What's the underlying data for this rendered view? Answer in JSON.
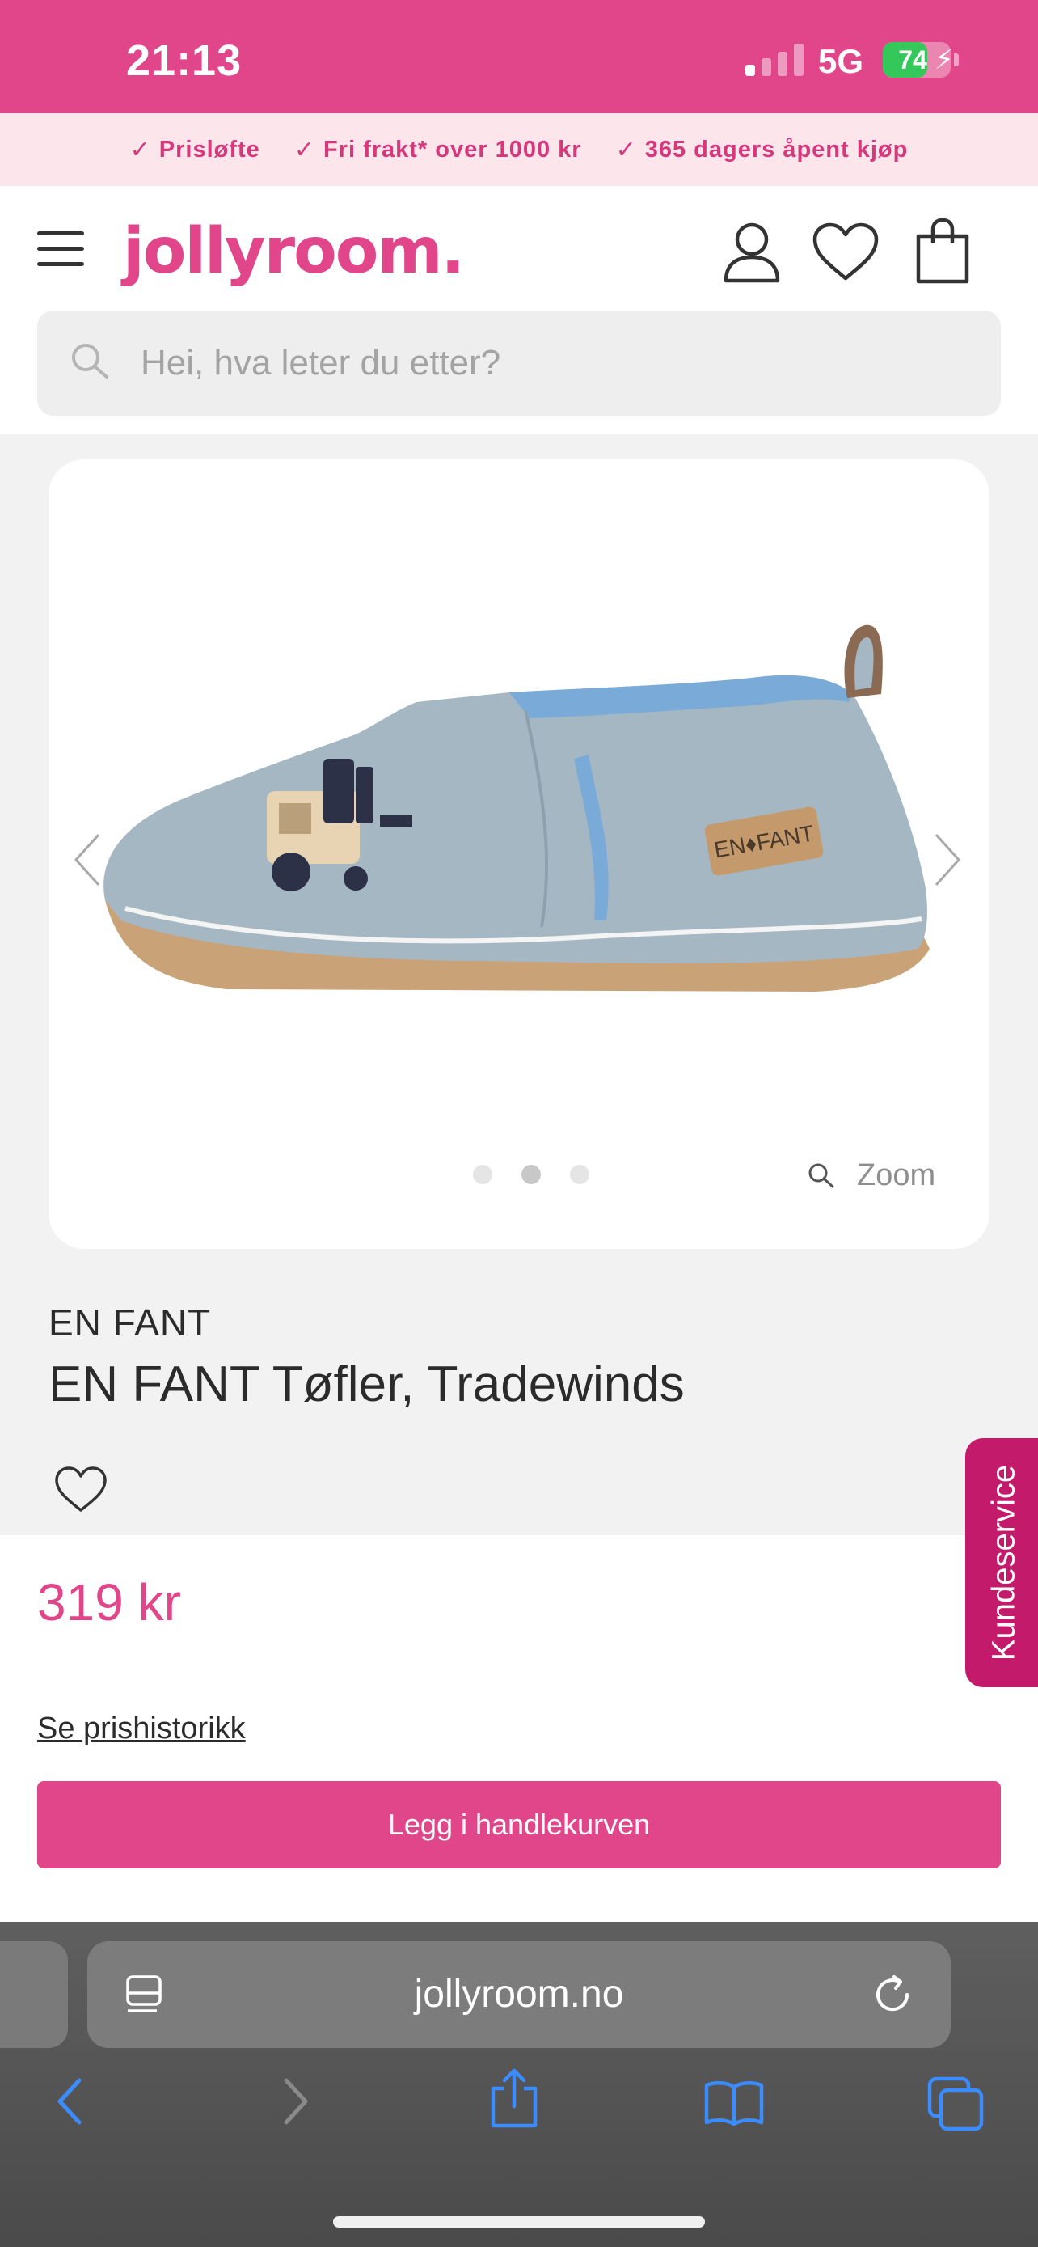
{
  "status_bar": {
    "time": "21:13",
    "network": "5G",
    "battery_percent": "74",
    "battery_level": 0.74,
    "signal_bars_active": 1
  },
  "promo": {
    "items": [
      "Prisløfte",
      "Fri frakt* over 1000 kr",
      "365 dagers åpent kjøp"
    ]
  },
  "header": {
    "logo": "jollyroom.",
    "search_placeholder": "Hei, hva leter du etter?"
  },
  "gallery": {
    "image_count": 3,
    "active_index": 1,
    "zoom_label": "Zoom",
    "tag_text": "EN♦FANT"
  },
  "product": {
    "brand": "EN FANT",
    "name": "EN FANT Tøfler, Tradewinds",
    "price": "319 kr",
    "price_history_link": "Se prishistorikk",
    "cart_button": "Legg i handlekurven"
  },
  "customer_service": {
    "label": "Kundeservice"
  },
  "browser": {
    "url": "jollyroom.no"
  },
  "colors": {
    "brand_pink": "#e1468a",
    "promo_bg": "#fce6ec",
    "cs_tab": "#c41a6c",
    "ios_blue": "#3b8cff"
  }
}
